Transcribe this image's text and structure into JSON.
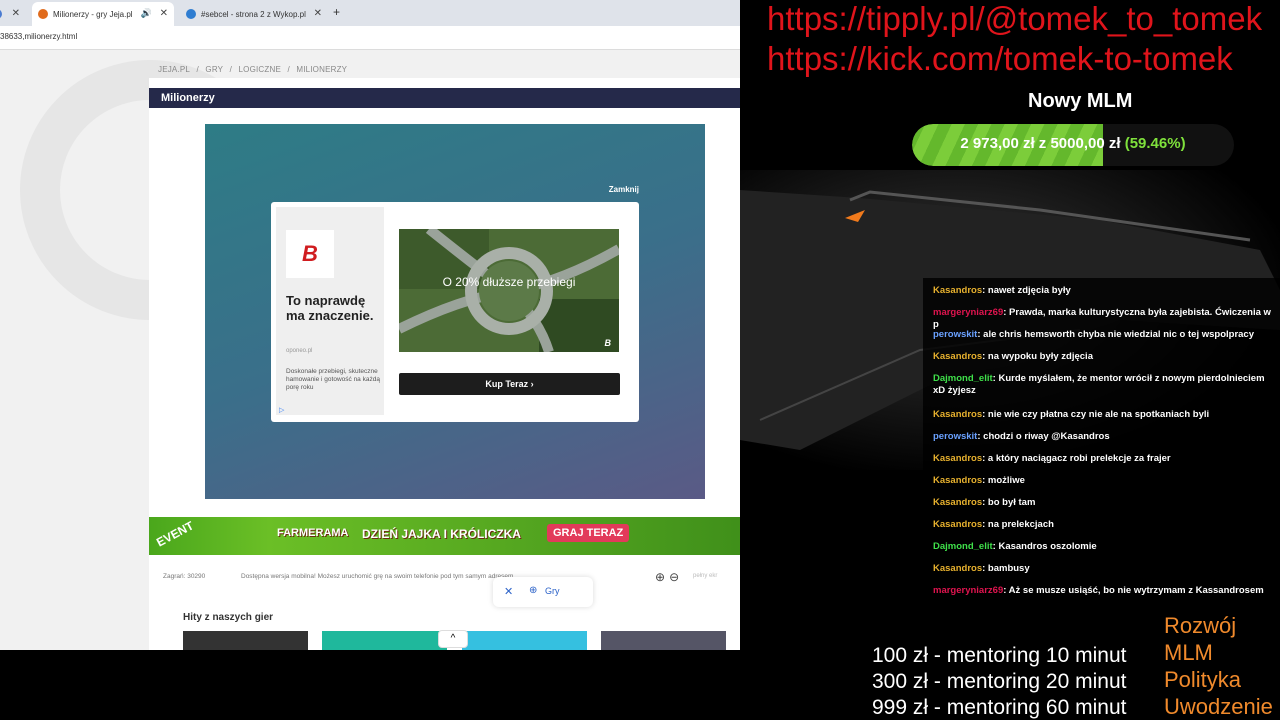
{
  "browser": {
    "tabs": [
      {
        "label": "",
        "favicon_color": "#4a7bd1"
      },
      {
        "label": "Milionerzy - gry Jeja.pl",
        "favicon_color": "#e06b1c",
        "active": true,
        "audio": "🔊"
      },
      {
        "label": "#sebcel - strona 2 z Wykop.pl",
        "favicon_color": "#2f7dd1"
      }
    ],
    "new_tab": "+",
    "close_glyph": "✕",
    "url": "38633,milionerzy.html"
  },
  "page": {
    "breadcrumb": [
      "JEJA.PL",
      "/",
      "GRY",
      "/",
      "LOGICZNE",
      "/",
      "MILIONERZY"
    ],
    "title": "Milionerzy",
    "close_ad": "Zamknij",
    "ad": {
      "logo": "B",
      "headline": "To naprawdę ma znaczenie.",
      "domain": "oponeo.pl",
      "description": "Doskonałe przebiegi, skuteczne hamowanie i gotowość na każdą porę roku",
      "info_icon": "▷",
      "image_text": "O 20% dłuższe przebiegi",
      "image_logo": "B",
      "cta": "Kup Teraz ›"
    },
    "banner": {
      "event": "EVENT",
      "brand": "FARMERAMA",
      "text": "DZIEŃ JAJKA I KRÓLICZKA",
      "cta": "GRAJ TERAZ"
    },
    "stats": {
      "views": "Zagrań: 30290",
      "mobile": "Dostępna wersja mobilna! Możesz uruchomić grę na swoim telefonie pod tym samym adresem.",
      "zoom_in": "⊕",
      "zoom_out": "⊖",
      "fullscreen": "pełny ekr"
    },
    "hits_title": "Hity z naszych gier",
    "scroll_up": "^",
    "gry_pill": {
      "close": "✕",
      "plus": "⊕",
      "label": "Gry"
    }
  },
  "overlay": {
    "links": [
      "https://tipply.pl/@tomek_to_tomek",
      "https://kick.com/tomek-to-tomek"
    ],
    "goal": {
      "title": "Nowy MLM",
      "text": "2 973,00 zł  z  5000,00 zł",
      "pct": "(59.46%)",
      "fraction": 0.5946
    },
    "chat": [
      {
        "user": "Kasandros",
        "cls": "u-kasandros",
        "text": ": nawet zdjęcia były"
      },
      {
        "user": "margeryniarz69",
        "cls": "u-margery",
        "text": ": Prawda, marka kulturystyczna była zajebista. Ćwiczenia w p"
      },
      {
        "user": "perowskit",
        "cls": "u-perowskit",
        "text": ": ale chris hemsworth chyba nie wiedzial nic o tej wspolpracy"
      },
      {
        "user": "Kasandros",
        "cls": "u-kasandros",
        "text": ": na wypoku były zdjęcia"
      },
      {
        "user": "Dajmond_elit",
        "cls": "u-dajmond",
        "text": ": Kurde myślałem, że mentor wrócił z nowym pierdolnieciem xD żyjesz"
      },
      {
        "user": "Kasandros",
        "cls": "u-kasandros",
        "text": ": nie wie czy płatna czy nie ale na spotkaniach byli"
      },
      {
        "user": "perowskit",
        "cls": "u-perowskit",
        "text": ": chodzi o riway @Kasandros"
      },
      {
        "user": "Kasandros",
        "cls": "u-kasandros",
        "text": ": a który naciągacz robi prelekcje za frajer"
      },
      {
        "user": "Kasandros",
        "cls": "u-kasandros",
        "text": ": możliwe"
      },
      {
        "user": "Kasandros",
        "cls": "u-kasandros",
        "text": ": bo był tam"
      },
      {
        "user": "Kasandros",
        "cls": "u-kasandros",
        "text": ": na prelekcjach"
      },
      {
        "user": "Dajmond_elit",
        "cls": "u-dajmond",
        "text": ": Kasandros oszolomie"
      },
      {
        "user": "Kasandros",
        "cls": "u-kasandros",
        "text": ": bambusy"
      },
      {
        "user": "margeryniarz69",
        "cls": "u-margery",
        "text": ": Aż se musze usiąść, bo nie wytrzymam z Kassandrosem"
      }
    ],
    "prices": [
      "100 zł - mentoring 10 minut",
      "300 zł - mentoring 20 minut",
      "999 zł - mentoring 60 minut"
    ],
    "topics": [
      "Rozwój",
      "MLM",
      "Polityka",
      "Uwodzenie"
    ]
  }
}
